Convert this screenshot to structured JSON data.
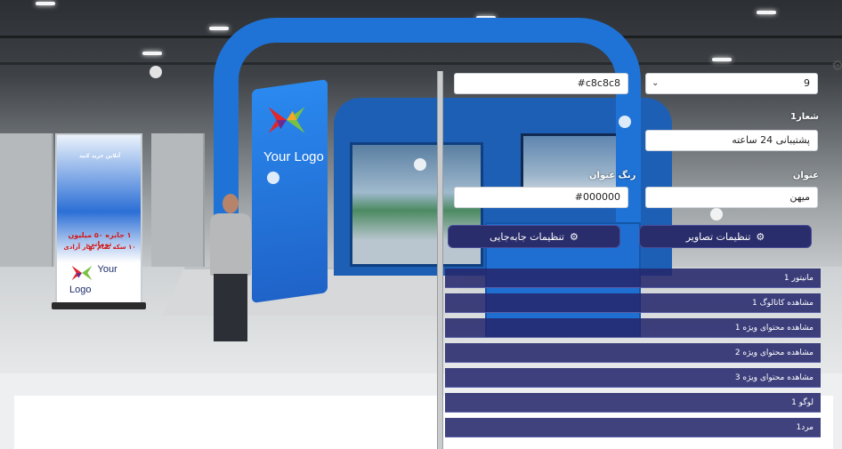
{
  "scene": {
    "rollup": {
      "line1": "آنلاین خرید کنید",
      "line2": "۱ جایزه ۵۰ میلیون تومانی",
      "line3": "۱۰ سکه تمام بهار آزادی",
      "logo_text": "Your Logo"
    },
    "column_logo_text": "Your Logo"
  },
  "settings": {
    "top_left_color": "#c8c8c8",
    "top_right_select": "9",
    "slogan_label": "شعار1",
    "slogan_value": "پشتیبانی 24 ساعته",
    "title_color_label": "رنگ عنوان",
    "title_color_value": "#000000",
    "title_label": "عنوان",
    "title_value": "میهن",
    "buttons": {
      "image_settings": "تنظیمات تصاویر",
      "move_settings": "تنظیمات جابه‌جایی"
    },
    "rows": [
      "مانیتور 1",
      "مشاهده کاتالوگ 1",
      "مشاهده محتوای ویژه 1",
      "مشاهده محتوای ویژه 2",
      "مشاهده محتوای ویژه 3",
      "لوگو 1",
      "مرد1"
    ]
  },
  "colors": {
    "accent_dark": "#2a2d6b",
    "booth_blue": "#1f73d6"
  },
  "icons": {
    "settings": "gear-icon",
    "dropdown": "chevron-down-icon"
  }
}
